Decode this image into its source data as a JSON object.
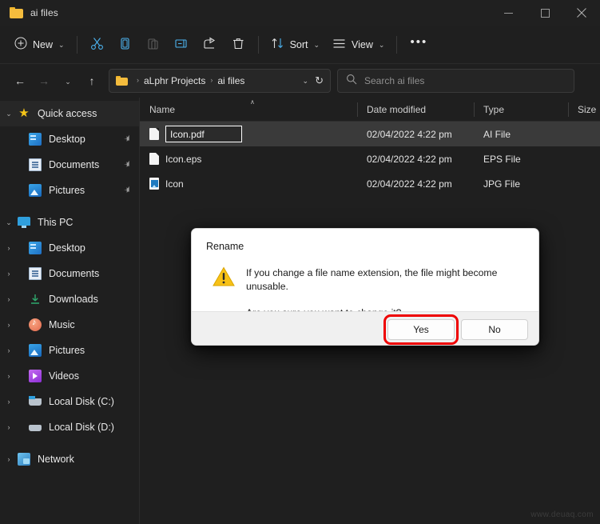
{
  "window": {
    "title": "ai files",
    "minimize_label": "─",
    "maximize_label": "□",
    "close_label": "✕"
  },
  "toolbar": {
    "new_label": "New",
    "cut_label": "Cut",
    "copy_label": "Copy",
    "paste_label": "Paste",
    "rename_label": "Rename",
    "share_label": "Share",
    "delete_label": "Delete",
    "sort_label": "Sort",
    "view_label": "View",
    "more_label": "•••",
    "chevron": "⌄"
  },
  "nav": {
    "back": "←",
    "forward": "→",
    "recent": "⌄",
    "up": "↑",
    "refresh": "↻",
    "address_chevron": "⌄",
    "breadcrumb": [
      "aLphr Projects",
      "ai files"
    ],
    "breadcrumb_sep": "›"
  },
  "search": {
    "placeholder": "Search ai files",
    "icon": "search-icon"
  },
  "sidebar": {
    "items": [
      {
        "label": "Quick access",
        "icon": "star-icon",
        "expander": "⌄",
        "level": 0,
        "pinned": false,
        "root": true
      },
      {
        "label": "Desktop",
        "icon": "desktop-icon",
        "expander": "",
        "level": 1,
        "pinned": true,
        "root": false
      },
      {
        "label": "Documents",
        "icon": "documents-icon",
        "expander": "",
        "level": 1,
        "pinned": true,
        "root": false
      },
      {
        "label": "Pictures",
        "icon": "pictures-icon",
        "expander": "",
        "level": 1,
        "pinned": true,
        "root": false
      },
      {
        "label": "This PC",
        "icon": "pc-icon",
        "expander": "⌄",
        "level": 0,
        "pinned": false,
        "root": false
      },
      {
        "label": "Desktop",
        "icon": "desktop-icon",
        "expander": "›",
        "level": 1,
        "pinned": false,
        "root": false
      },
      {
        "label": "Documents",
        "icon": "documents-icon",
        "expander": "›",
        "level": 1,
        "pinned": false,
        "root": false
      },
      {
        "label": "Downloads",
        "icon": "downloads-icon",
        "expander": "›",
        "level": 1,
        "pinned": false,
        "root": false
      },
      {
        "label": "Music",
        "icon": "music-icon",
        "expander": "›",
        "level": 1,
        "pinned": false,
        "root": false
      },
      {
        "label": "Pictures",
        "icon": "pictures-icon",
        "expander": "›",
        "level": 1,
        "pinned": false,
        "root": false
      },
      {
        "label": "Videos",
        "icon": "videos-icon",
        "expander": "›",
        "level": 1,
        "pinned": false,
        "root": false
      },
      {
        "label": "Local Disk (C:)",
        "icon": "disk-c-icon",
        "expander": "›",
        "level": 1,
        "pinned": false,
        "root": false
      },
      {
        "label": "Local Disk (D:)",
        "icon": "disk-d-icon",
        "expander": "›",
        "level": 1,
        "pinned": false,
        "root": false
      },
      {
        "label": "Network",
        "icon": "network-icon",
        "expander": "›",
        "level": 0,
        "pinned": false,
        "root": false
      }
    ],
    "pin_glyph": "✔"
  },
  "filelist": {
    "columns": [
      "Name",
      "Date modified",
      "Type",
      "Size"
    ],
    "sort_caret": "∧",
    "rows": [
      {
        "name": "Icon.pdf",
        "date": "02/04/2022 4:22 pm",
        "type": "AI File",
        "size": "",
        "icon": "file-icon",
        "editing": true,
        "selected": true
      },
      {
        "name": "Icon.eps",
        "date": "02/04/2022 4:22 pm",
        "type": "EPS File",
        "size": "",
        "icon": "file-icon",
        "editing": false,
        "selected": false
      },
      {
        "name": "Icon",
        "date": "02/04/2022 4:22 pm",
        "type": "JPG File",
        "size": "",
        "icon": "image-file-icon",
        "editing": false,
        "selected": false
      }
    ]
  },
  "dialog": {
    "title": "Rename",
    "icon": "warning-icon",
    "message_line1": "If you change a file name extension, the file might become unusable.",
    "message_line2": "Are you sure you want to change it?",
    "yes_label": "Yes",
    "no_label": "No",
    "highlight_color": "#ee0000"
  },
  "watermark": {
    "text": "www.deuaq.com"
  }
}
